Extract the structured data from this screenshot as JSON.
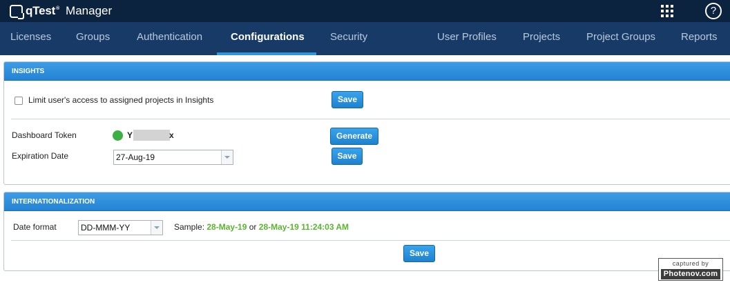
{
  "app": {
    "brand": "qTest",
    "trademark": "®",
    "product": "Manager"
  },
  "topbar": {
    "help_glyph": "?"
  },
  "nav": {
    "items": [
      {
        "label": "Licenses"
      },
      {
        "label": "Groups"
      },
      {
        "label": "Authentication"
      },
      {
        "label": "Configurations",
        "active": true
      },
      {
        "label": "Security"
      },
      {
        "label": "User Profiles"
      },
      {
        "label": "Projects"
      },
      {
        "label": "Project Groups"
      },
      {
        "label": "Reports"
      }
    ]
  },
  "insights": {
    "title": "INSIGHTS",
    "limit_access_label": "Limit user's access to assigned projects in Insights",
    "limit_access_checked": false,
    "save_label": "Save",
    "token_label": "Dashboard Token",
    "token_prefix": "Y",
    "token_suffix": "x",
    "token_status": "active",
    "generate_label": "Generate",
    "expiration_label": "Expiration Date",
    "expiration_value": "27-Aug-19",
    "expiration_save_label": "Save"
  },
  "internationalization": {
    "title": "INTERNATIONALIZATION",
    "date_format_label": "Date format",
    "date_format_value": "DD-MMM-YY",
    "sample_label": "Sample:",
    "sample_date": "28-May-19",
    "sample_or": "or",
    "sample_datetime": "28-May-19 11:24:03 AM",
    "save_label": "Save"
  },
  "watermark": {
    "line1": "captured by",
    "line2": "Photenov.com"
  },
  "colors": {
    "topbar": "#0c2340",
    "navbar": "#173b66",
    "accent": "#2c97de",
    "button": "#1e82cf",
    "sample_text": "#5ab52e",
    "status": "#3cb043"
  }
}
